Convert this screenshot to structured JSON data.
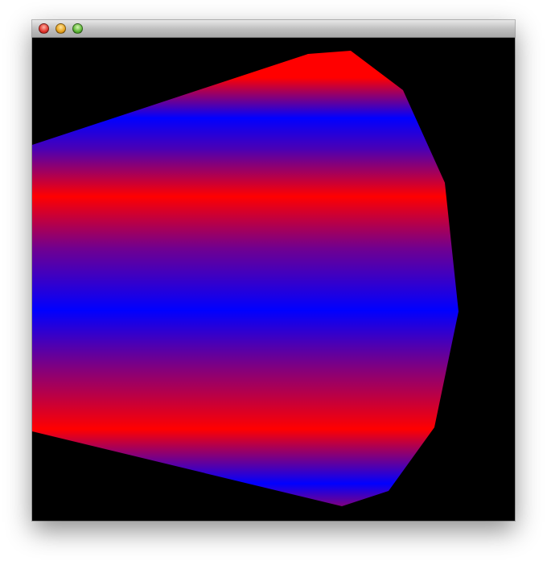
{
  "window": {
    "title": "",
    "controls": [
      {
        "name": "close",
        "icon": "close-traffic-light-icon"
      },
      {
        "name": "minimize",
        "icon": "minimize-traffic-light-icon"
      },
      {
        "name": "zoom",
        "icon": "zoom-traffic-light-icon"
      }
    ]
  },
  "scene": {
    "background": "#000000",
    "shape": "cone",
    "colors": [
      "#ff0000",
      "#0000ff"
    ]
  }
}
